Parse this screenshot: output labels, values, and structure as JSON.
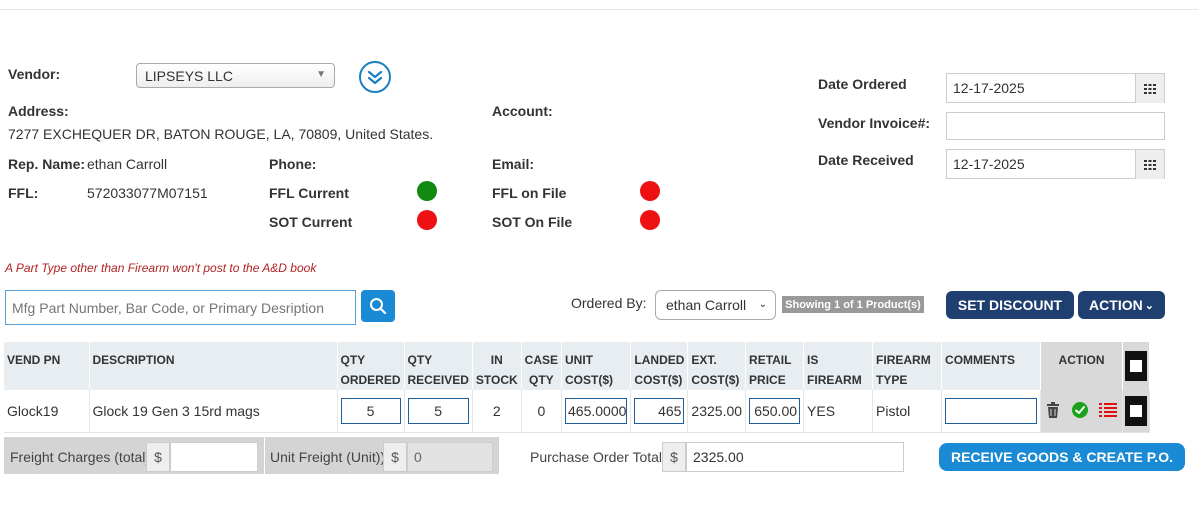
{
  "vendor": {
    "label": "Vendor:",
    "selected": "LIPSEYS LLC",
    "address_label": "Address:",
    "address": "7277 EXCHEQUER DR, BATON ROUGE, LA, 70809, United States.",
    "rep_label": "Rep. Name:",
    "rep_value": "ethan Carroll",
    "ffl_label": "FFL:",
    "ffl_value": "572033077M07151",
    "phone_label": "Phone:",
    "ffl_current_label": "FFL Current",
    "sot_current_label": "SOT Current",
    "account_label": "Account:",
    "email_label": "Email:",
    "ffl_on_file_label": "FFL on File",
    "sot_on_file_label": "SOT On File"
  },
  "status_colors": {
    "green": "#118a11",
    "red": "#ee1111"
  },
  "dates": {
    "ordered_label": "Date Ordered",
    "ordered_value": "12-17-2025",
    "invoice_label": "Vendor Invoice#:",
    "invoice_value": "",
    "received_label": "Date Received",
    "received_value": "12-17-2025"
  },
  "warning": "A Part Type other than Firearm won't post to the A&D book",
  "search": {
    "placeholder": "Mfg Part Number, Bar Code, or Primary Desription"
  },
  "ordered_by": {
    "label": "Ordered By:",
    "selected": "ethan Carroll"
  },
  "showing_badge": "Showing 1 of 1 Product(s)",
  "buttons": {
    "set_discount": "SET DISCOUNT",
    "action": "ACTION",
    "receive": "RECEIVE GOODS & CREATE P.O."
  },
  "table": {
    "headers": {
      "vend_pn": "VEND PN",
      "description": "DESCRIPTION",
      "qty_ordered_1": "QTY",
      "qty_ordered_2": "ORDERED",
      "qty_received_1": "QTY",
      "qty_received_2": "RECEIVED",
      "in_stock_1": "IN",
      "in_stock_2": "STOCK",
      "case_qty_1": "CASE",
      "case_qty_2": "QTY",
      "unit_cost_1": "UNIT",
      "unit_cost_2": "COST($)",
      "landed_cost_1": "LANDED",
      "landed_cost_2": "COST($)",
      "ext_cost_1": "EXT.",
      "ext_cost_2": "COST($)",
      "retail_price_1": "RETAIL",
      "retail_price_2": "PRICE",
      "is_firearm": "IS FIREARM",
      "firearm_type_1": "FIREARM",
      "firearm_type_2": "TYPE",
      "comments": "COMMENTS",
      "action": "ACTION"
    },
    "row": {
      "vend_pn": "Glock19",
      "description": "Glock 19 Gen 3 15rd mags",
      "qty_ordered": "5",
      "qty_received": "5",
      "in_stock": "2",
      "case_qty": "0",
      "unit_cost": "465.0000",
      "landed_cost": "465",
      "ext_cost": "2325.00",
      "retail_price": "650.00",
      "is_firearm": "YES",
      "firearm_type": "Pistol",
      "comments": ""
    }
  },
  "footer": {
    "freight_label": "Freight Charges (total)",
    "freight_value": "",
    "unit_freight_label": "Unit Freight (Unit))",
    "unit_freight_value": "0",
    "currency": "$",
    "po_total_label": "Purchase Order Total",
    "po_total_value": "2325.00"
  }
}
